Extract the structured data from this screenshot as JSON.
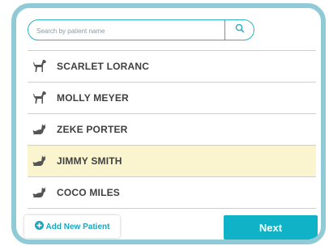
{
  "search": {
    "placeholder": "Search by patient name",
    "icon": "search-icon"
  },
  "patients": [
    {
      "name": "SCARLET LORANC",
      "species": "dog",
      "icon": "dog-icon",
      "selected": false
    },
    {
      "name": "MOLLY MEYER",
      "species": "dog",
      "icon": "dog-icon",
      "selected": false
    },
    {
      "name": "ZEKE PORTER",
      "species": "cat",
      "icon": "cat-icon",
      "selected": false
    },
    {
      "name": "JIMMY SMITH",
      "species": "cat",
      "icon": "cat-icon",
      "selected": true
    },
    {
      "name": "COCO MILES",
      "species": "cat",
      "icon": "cat-icon",
      "selected": false
    }
  ],
  "actions": {
    "add_label": "Add New Patient",
    "add_icon": "plus-circle-icon",
    "next_label": "Next"
  },
  "colors": {
    "accent": "#0fb2c7",
    "frame": "#8fcad6",
    "selected_row": "#fbf5cf",
    "text": "#3f3f3f"
  }
}
